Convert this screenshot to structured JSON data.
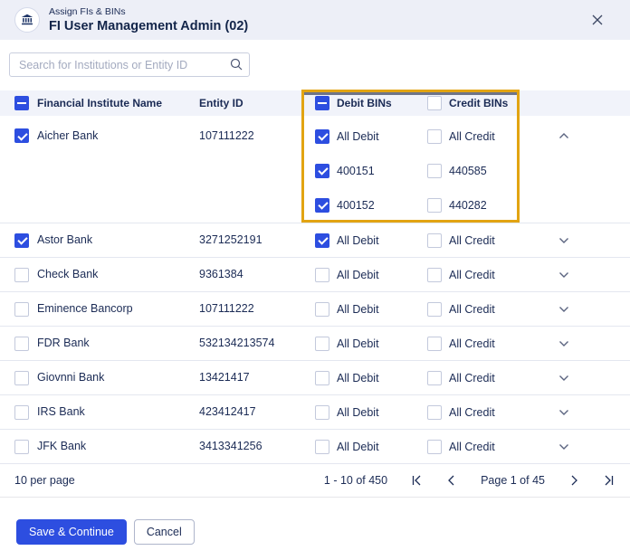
{
  "modal": {
    "eyebrow": "Assign FIs & BINs",
    "title": "FI User Management Admin (02)",
    "icons": {
      "header": "bank-institution-icon",
      "close": "close-x-icon"
    }
  },
  "search": {
    "placeholder": "Search for Institutions or Entity ID",
    "value": "",
    "icon": "search-magnifier-icon"
  },
  "table": {
    "columns": {
      "select_all_state": "indeterminate",
      "name": "Financial Institute Name",
      "entity_id": "Entity ID",
      "debit": "Debit BINs",
      "debit_state": "indeterminate",
      "credit": "Credit BINs",
      "credit_state": "unchecked"
    },
    "highlight_color": "#E2A412",
    "rows": [
      {
        "name": "Aicher Bank",
        "entity_id": "107111222",
        "selected": "checked",
        "expanded": true,
        "debit_bins": [
          {
            "label": "All Debit",
            "state": "checked"
          },
          {
            "label": "400151",
            "state": "checked"
          },
          {
            "label": "400152",
            "state": "checked"
          }
        ],
        "credit_bins": [
          {
            "label": "All Credit",
            "state": "unchecked"
          },
          {
            "label": "440585",
            "state": "unchecked"
          },
          {
            "label": "440282",
            "state": "unchecked"
          }
        ]
      },
      {
        "name": "Astor Bank",
        "entity_id": "3271252191",
        "selected": "checked",
        "expanded": false,
        "debit_bins": [
          {
            "label": "All Debit",
            "state": "checked"
          }
        ],
        "credit_bins": [
          {
            "label": "All Credit",
            "state": "unchecked"
          }
        ]
      },
      {
        "name": "Check Bank",
        "entity_id": "9361384",
        "selected": "unchecked",
        "expanded": false,
        "debit_bins": [
          {
            "label": "All Debit",
            "state": "unchecked"
          }
        ],
        "credit_bins": [
          {
            "label": "All Credit",
            "state": "unchecked"
          }
        ]
      },
      {
        "name": "Eminence Bancorp",
        "entity_id": "107111222",
        "selected": "unchecked",
        "expanded": false,
        "debit_bins": [
          {
            "label": "All Debit",
            "state": "unchecked"
          }
        ],
        "credit_bins": [
          {
            "label": "All Credit",
            "state": "unchecked"
          }
        ]
      },
      {
        "name": "FDR Bank",
        "entity_id": "532134213574",
        "selected": "unchecked",
        "expanded": false,
        "debit_bins": [
          {
            "label": "All Debit",
            "state": "unchecked"
          }
        ],
        "credit_bins": [
          {
            "label": "All Credit",
            "state": "unchecked"
          }
        ]
      },
      {
        "name": "Giovnni Bank",
        "entity_id": "13421417",
        "selected": "unchecked",
        "expanded": false,
        "debit_bins": [
          {
            "label": "All Debit",
            "state": "unchecked"
          }
        ],
        "credit_bins": [
          {
            "label": "All Credit",
            "state": "unchecked"
          }
        ]
      },
      {
        "name": "IRS Bank",
        "entity_id": "423412417",
        "selected": "unchecked",
        "expanded": false,
        "debit_bins": [
          {
            "label": "All Debit",
            "state": "unchecked"
          }
        ],
        "credit_bins": [
          {
            "label": "All Credit",
            "state": "unchecked"
          }
        ]
      },
      {
        "name": "JFK Bank",
        "entity_id": "3413341256",
        "selected": "unchecked",
        "expanded": false,
        "debit_bins": [
          {
            "label": "All Debit",
            "state": "unchecked"
          }
        ],
        "credit_bins": [
          {
            "label": "All Credit",
            "state": "unchecked"
          }
        ]
      }
    ]
  },
  "pagination": {
    "per_page": "10 per page",
    "range": "1 - 10 of 450",
    "page": "Page 1 of 45",
    "icons": {
      "first": "first-page-icon",
      "prev": "chevron-left-icon",
      "next": "chevron-right-icon",
      "last": "last-page-icon"
    }
  },
  "footer": {
    "save_label": "Save & Continue",
    "cancel_label": "Cancel"
  },
  "colors": {
    "accent_blue": "#2D4EE0",
    "highlight_yellow": "#E2A412",
    "modal_header_bg": "#EDEFF7",
    "table_header_bg": "#F1F3FA",
    "text_navy": "#1B2B55",
    "row_border": "#E4E7F0"
  }
}
